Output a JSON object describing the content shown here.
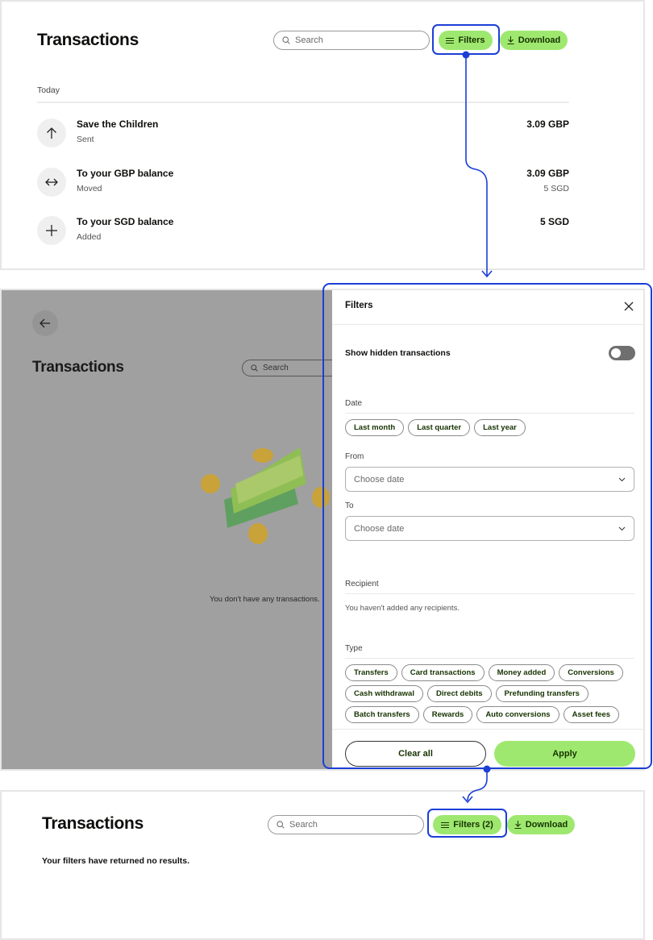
{
  "colors": {
    "accent": "#9fe870",
    "accent_text": "#163300",
    "highlight": "#1b3fd6",
    "overlay": "#a0a0a0"
  },
  "screen1": {
    "title": "Transactions",
    "search_placeholder": "Search",
    "filters_label": "Filters",
    "download_label": "Download",
    "section": "Today",
    "transactions": [
      {
        "name": "Save the Children",
        "status": "Sent",
        "amount": "3.09 GBP",
        "secondary": "",
        "icon": "arrow-up-icon"
      },
      {
        "name": "To your GBP balance",
        "status": "Moved",
        "amount": "3.09 GBP",
        "secondary": "5 SGD",
        "icon": "arrows-left-right-icon"
      },
      {
        "name": "To your SGD balance",
        "status": "Added",
        "amount": "5 SGD",
        "secondary": "",
        "icon": "plus-icon"
      }
    ]
  },
  "screen2": {
    "background": {
      "title": "Transactions",
      "search_placeholder": "Search",
      "empty_text": "You don't have any transactions."
    },
    "drawer": {
      "title": "Filters",
      "hidden_toggle_label": "Show hidden transactions",
      "hidden_toggle_on": false,
      "date_label": "Date",
      "date_chips": [
        "Last month",
        "Last quarter",
        "Last year"
      ],
      "from_label": "From",
      "from_placeholder": "Choose date",
      "to_label": "To",
      "to_placeholder": "Choose date",
      "recipient_label": "Recipient",
      "recipient_empty": "You haven't added any recipients.",
      "type_label": "Type",
      "type_chips": [
        "Transfers",
        "Card transactions",
        "Money added",
        "Conversions",
        "Cash withdrawal",
        "Direct debits",
        "Prefunding transfers",
        "Batch transfers",
        "Rewards",
        "Auto conversions",
        "Asset fees"
      ],
      "clear_label": "Clear all",
      "apply_label": "Apply"
    }
  },
  "screen3": {
    "title": "Transactions",
    "search_placeholder": "Search",
    "filters_label": "Filters (2)",
    "download_label": "Download",
    "empty_text": "Your filters have returned no results."
  }
}
